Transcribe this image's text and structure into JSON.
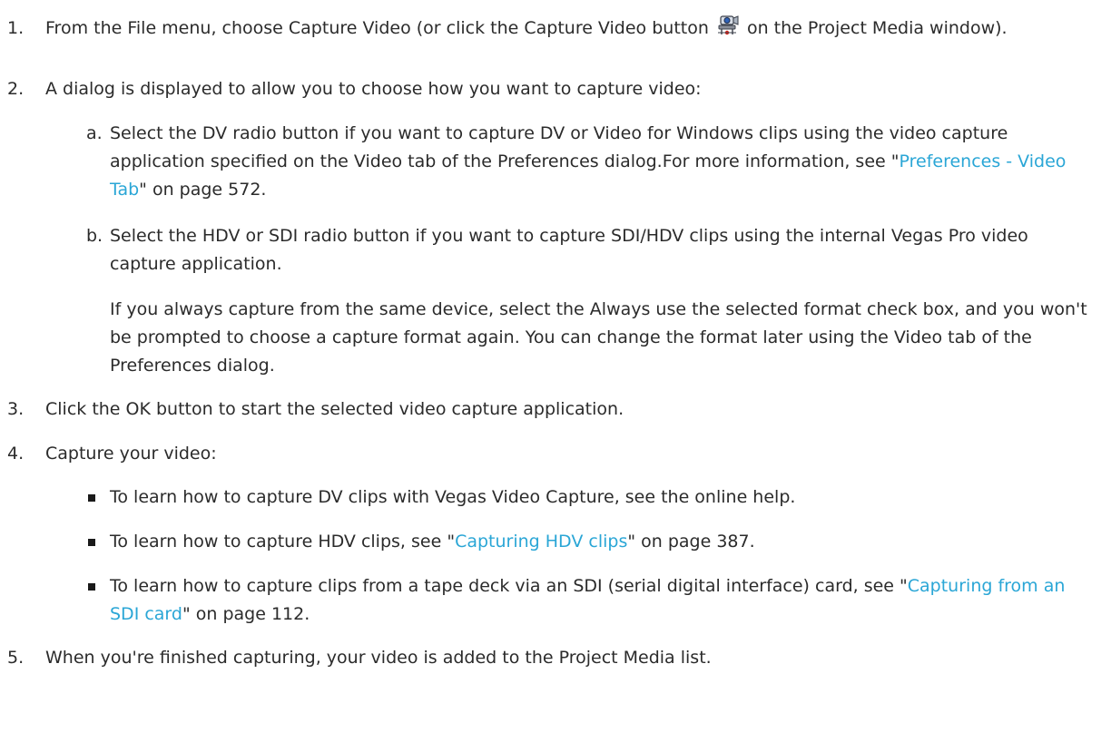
{
  "steps": [
    {
      "number": "1.",
      "text_before_icon": "From the File menu, choose Capture Video (or click the Capture Video button ",
      "icon": "capture-video-icon",
      "text_after_icon": " on the Project Media window)."
    },
    {
      "number": "2.",
      "text": "A dialog is displayed to allow you to choose how you want to capture video:",
      "substeps": [
        {
          "marker": "a.",
          "text_before_link": "Select the DV radio button if you want to capture DV or Video for Windows clips using the video capture application specified on the Video tab of the Preferences dialog.For more information, see \"",
          "link": "Preferences - Video Tab",
          "text_after_link": "\" on page 572."
        },
        {
          "marker": "b.",
          "text": "Select the HDV or SDI radio button if you want to capture SDI/HDV clips using the internal Vegas Pro video capture application.",
          "note": "If you always capture from the same device, select the Always use the selected format check box, and you won't be prompted to choose a capture format again. You can change the format later using the Video tab of the Preferences dialog."
        }
      ]
    },
    {
      "number": "3.",
      "text": "Click the OK button to start the selected video capture application."
    },
    {
      "number": "4.",
      "text": "Capture your video:",
      "bullets": [
        {
          "text": "To learn how to capture DV clips with Vegas Video Capture, see the online help."
        },
        {
          "text_before_link": "To learn how to capture HDV clips, see \"",
          "link": "Capturing HDV clips",
          "text_after_link": "\" on page 387."
        },
        {
          "text_before_link": "To learn how to capture clips from a tape deck via an SDI (serial digital interface) card, see \"",
          "link": "Capturing from an SDI card",
          "text_after_link": "\" on page 112."
        }
      ]
    },
    {
      "number": "5.",
      "text": "When you're finished capturing, your video is added to the Project Media list."
    }
  ],
  "colors": {
    "text": "#2b2b2b",
    "link": "#2aa6d6"
  }
}
